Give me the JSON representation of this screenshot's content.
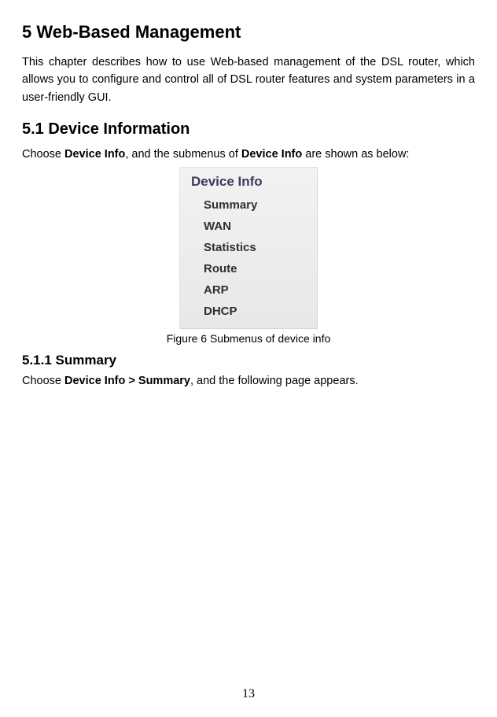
{
  "h1": "5  Web-Based Management",
  "para1": "This chapter describes how to use Web-based management of the DSL router, which allows you to configure and control all of DSL router features and system parameters in a user-friendly GUI.",
  "h2": "5.1  Device Information",
  "line2_a": "Choose ",
  "line2_b": "Device Info",
  "line2_c": ", and the submenus of ",
  "line2_d": "Device Info",
  "line2_e": " are shown as below:",
  "menu": {
    "title": "Device Info",
    "items": [
      "Summary",
      "WAN",
      "Statistics",
      "Route",
      "ARP",
      "DHCP"
    ]
  },
  "caption": "Figure 6 Submenus of device info",
  "h3": "5.1.1  Summary",
  "line3_a": "Choose ",
  "line3_b": "Device Info > Summary",
  "line3_c": ", and the following page appears.",
  "page_number": "13"
}
